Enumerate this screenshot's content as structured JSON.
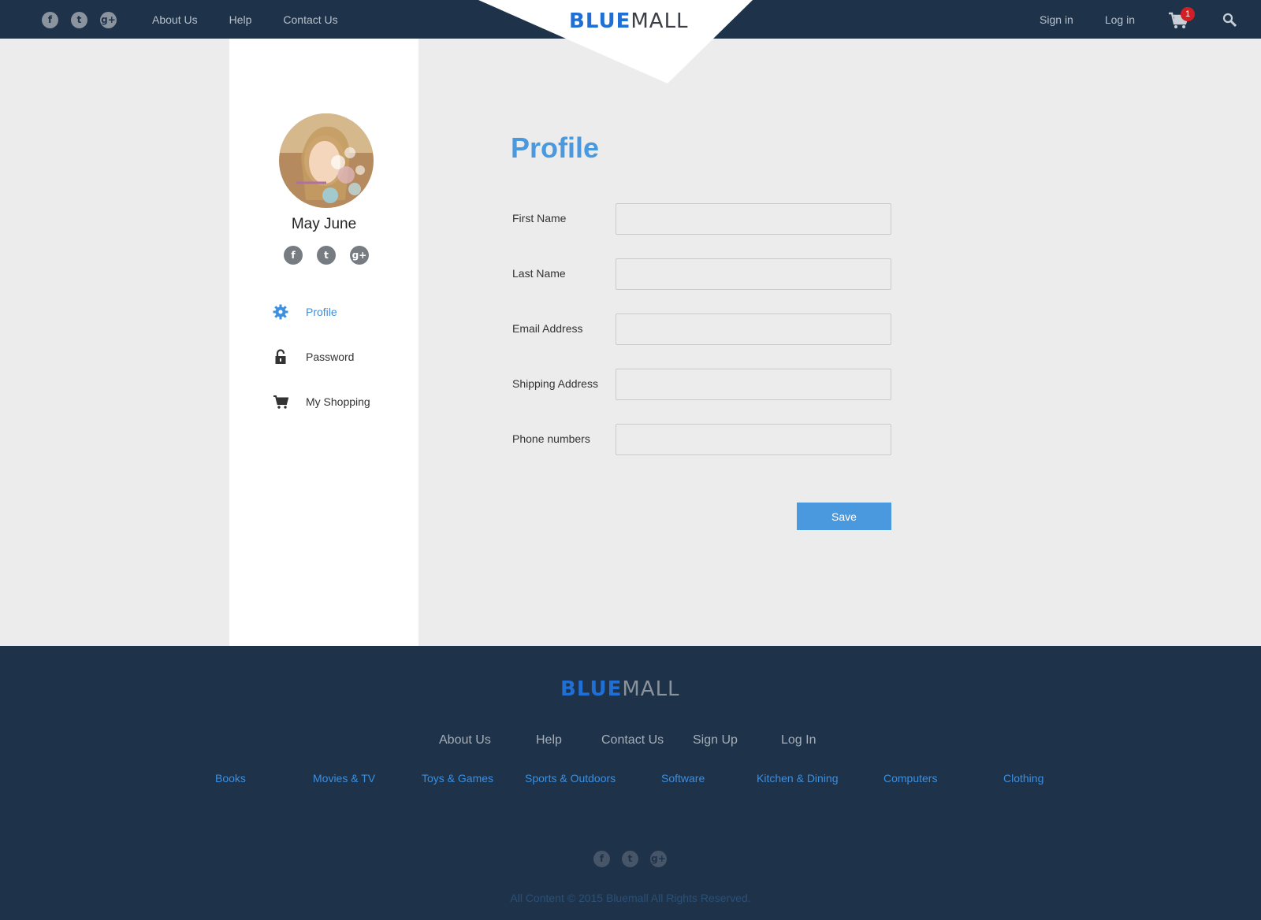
{
  "header": {
    "social": [
      "f",
      "t",
      "g+"
    ],
    "nav": [
      "About Us",
      "Help",
      "Contact Us"
    ],
    "logo": {
      "blue": "BLUE",
      "dark": "MALL"
    },
    "right_nav": [
      "Sign in",
      "Log in"
    ],
    "cart_count": "1"
  },
  "sidebar": {
    "user_name": "May June",
    "social": [
      "f",
      "t",
      "g+"
    ],
    "menu": [
      {
        "label": "Profile",
        "icon": "gear-icon",
        "active": true
      },
      {
        "label": "Password",
        "icon": "lock-icon",
        "active": false
      },
      {
        "label": "My Shopping",
        "icon": "cart-icon",
        "active": false
      }
    ]
  },
  "main": {
    "title": "Profile",
    "fields": [
      {
        "label": "First Name",
        "value": ""
      },
      {
        "label": "Last Name",
        "value": ""
      },
      {
        "label": "Email Address",
        "value": ""
      },
      {
        "label": "Shipping Address",
        "value": ""
      },
      {
        "label": "Phone numbers",
        "value": ""
      }
    ],
    "save_label": "Save"
  },
  "footer": {
    "logo": {
      "blue": "BLUE",
      "dark": "MALL"
    },
    "nav": [
      "About Us",
      "Help",
      "Contact Us",
      "Sign Up",
      "Log In"
    ],
    "categories": [
      "Books",
      "Movies & TV",
      "Toys & Games",
      "Sports & Outdoors",
      "Software",
      "Kitchen & Dining",
      "Computers",
      "Clothing"
    ],
    "social": [
      "f",
      "t",
      "g+"
    ],
    "copyright": "All Content © 2015 Bluemall All Rights Reserved."
  },
  "colors": {
    "accent": "#4a98de",
    "header_bg": "#1e3249",
    "badge": "#d11f26"
  }
}
